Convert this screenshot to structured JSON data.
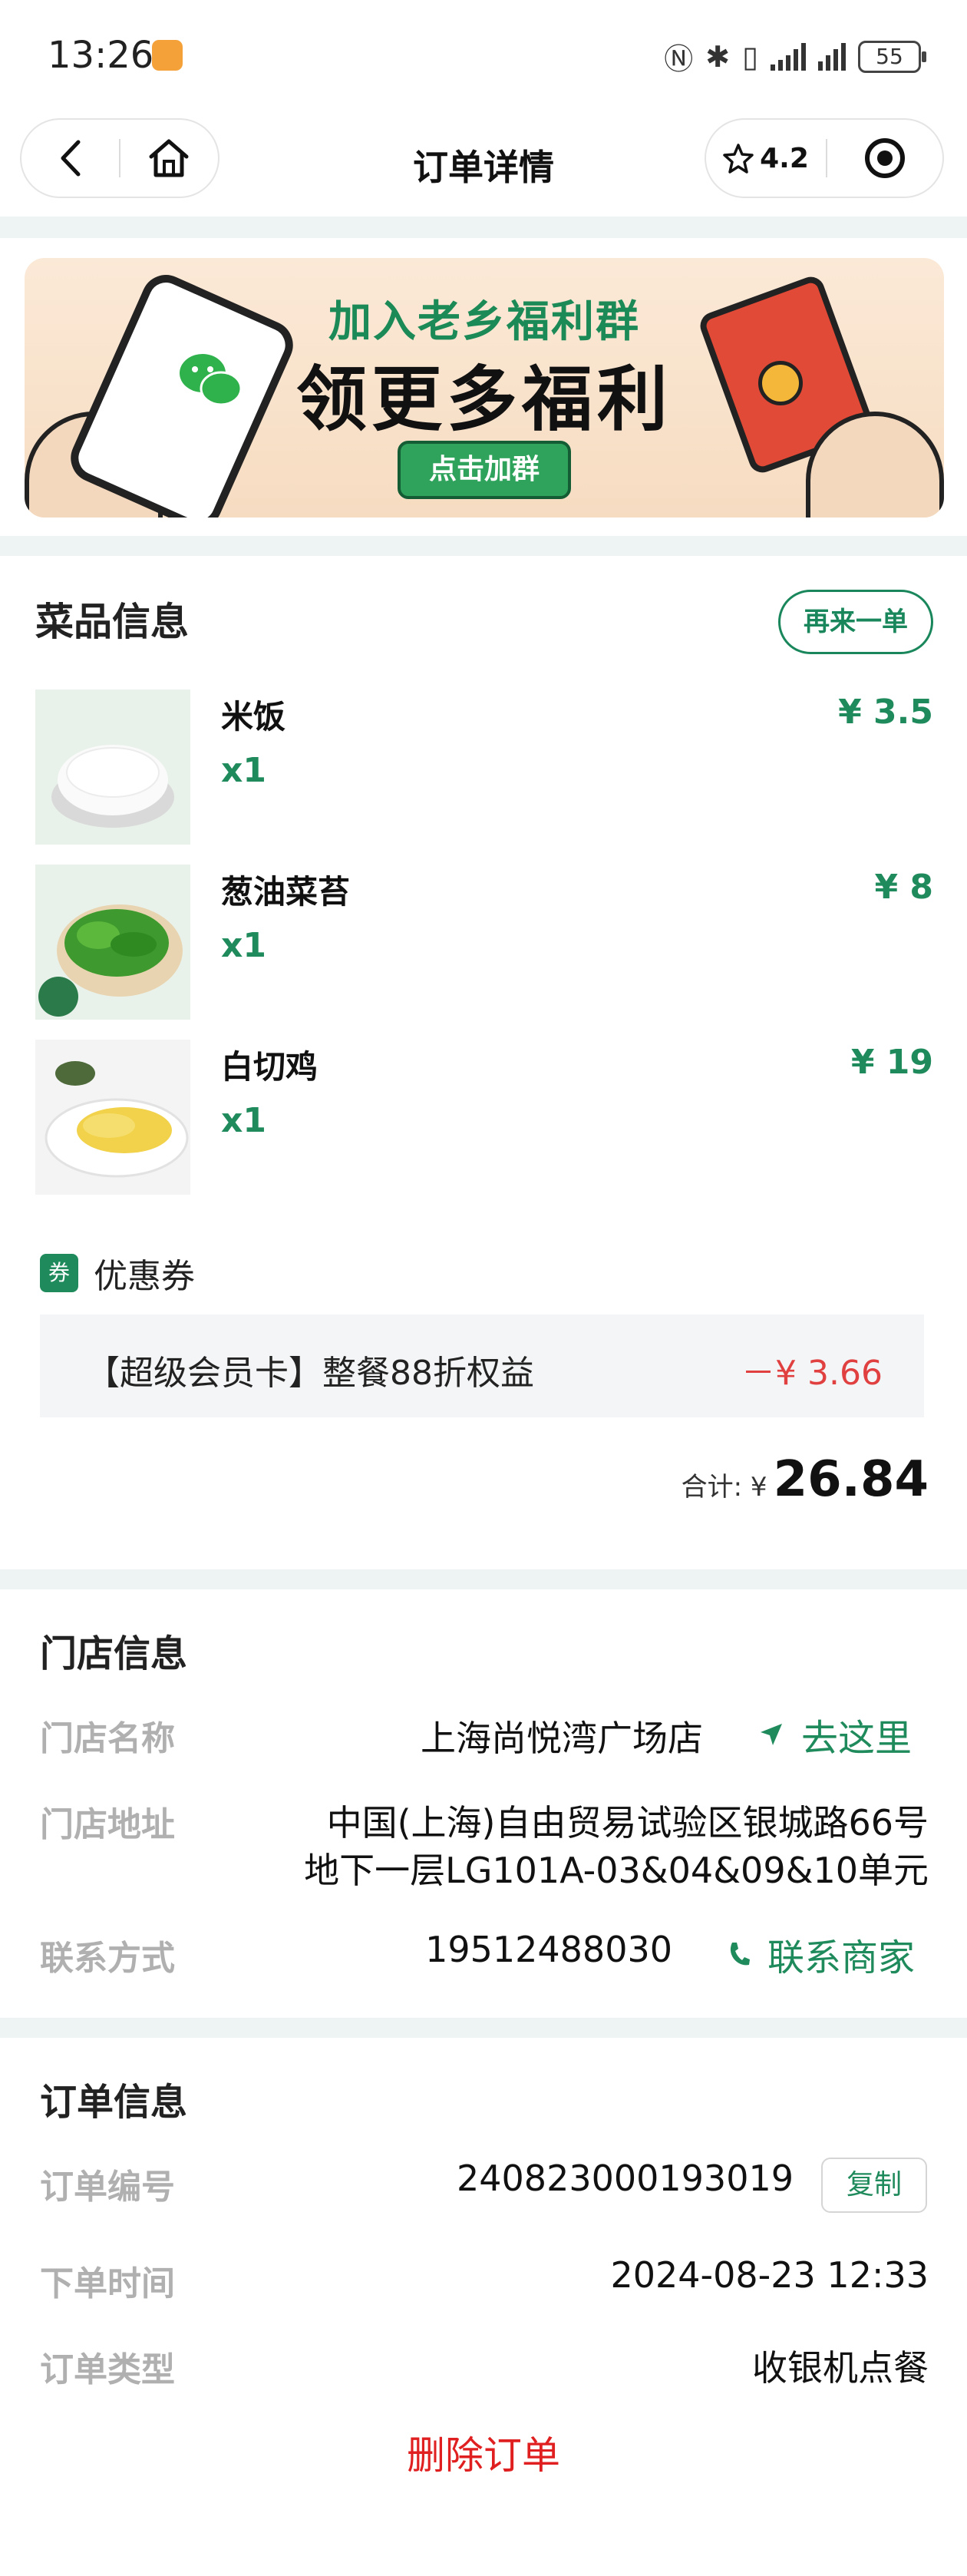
{
  "status_bar": {
    "time": "13:26",
    "battery": "55"
  },
  "nav": {
    "title": "订单详情",
    "rating": "4.2"
  },
  "banner": {
    "line1": "加入老乡福利群",
    "line2": "领更多福利",
    "button": "点击加群"
  },
  "dishes_section": {
    "title": "菜品信息",
    "reorder_label": "再来一单",
    "items": [
      {
        "name": "米饭",
        "qty": "x1",
        "price": "¥ 3.5"
      },
      {
        "name": "葱油菜苔",
        "qty": "x1",
        "price": "¥ 8"
      },
      {
        "name": "白切鸡",
        "qty": "x1",
        "price": "¥ 19"
      }
    ],
    "coupon": {
      "badge": "券",
      "title": "优惠券",
      "name": "【超级会员卡】整餐88折权益",
      "discount": "－¥ 3.66"
    },
    "total_label": "合计: ¥",
    "total_value": "26.84"
  },
  "store_section": {
    "title": "门店信息",
    "name_label": "门店名称",
    "name_value": "上海尚悦湾广场店",
    "navigate_label": "去这里",
    "address_label": "门店地址",
    "address_line1": "中国(上海)自由贸易试验区银城路66号",
    "address_line2": "地下一层LG101A-03&04&09&10单元",
    "contact_label": "联系方式",
    "contact_value": "19512488030",
    "call_label": "联系商家"
  },
  "order_section": {
    "title": "订单信息",
    "number_label": "订单编号",
    "number_value": "240823000193019",
    "copy_label": "复制",
    "time_label": "下单时间",
    "time_value": "2024-08-23 12:33",
    "type_label": "订单类型",
    "type_value": "收银机点餐",
    "delete_label": "删除订单"
  },
  "colors": {
    "accent": "#1f8a5b",
    "danger": "#e02020",
    "muted": "#b0b0b0",
    "divider": "#eef3f3"
  }
}
